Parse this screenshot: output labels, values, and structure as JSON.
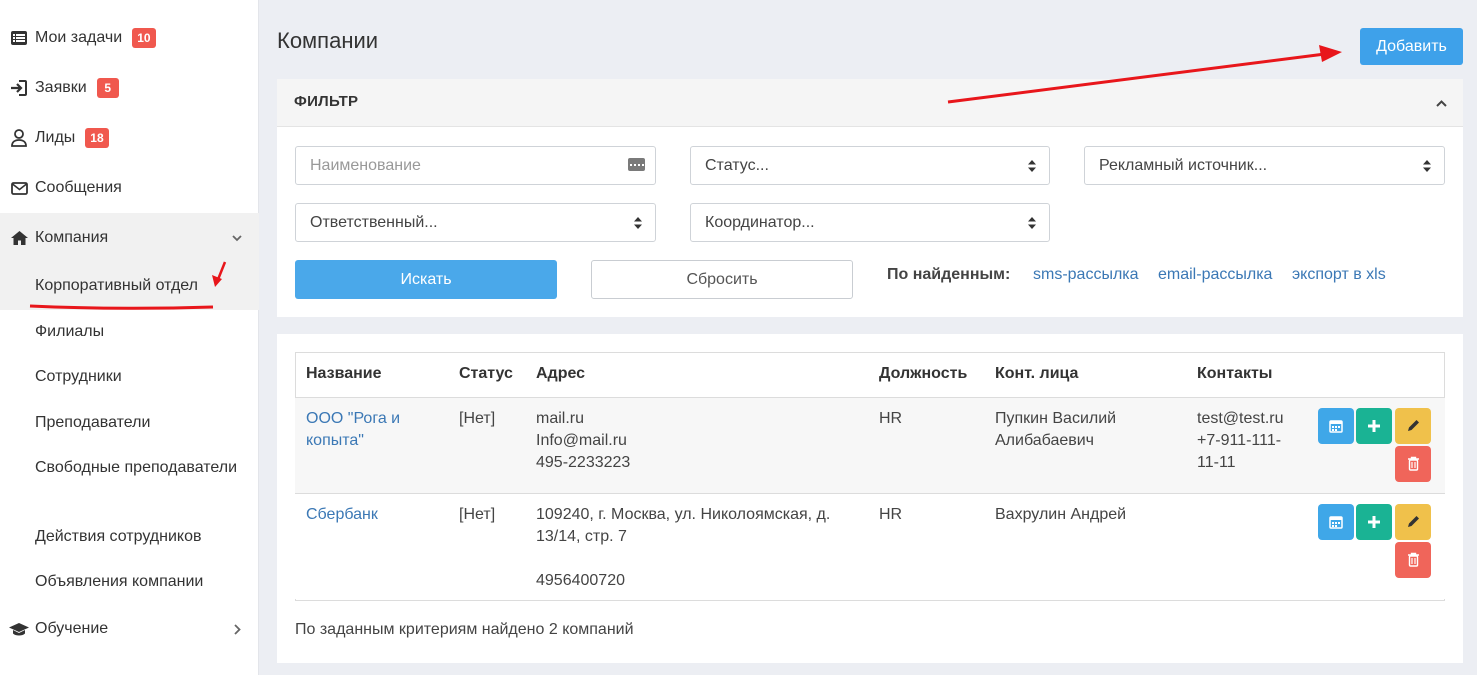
{
  "sidebar": {
    "items": [
      {
        "label": "Мои задачи",
        "badge": "10",
        "icon": "list-icon"
      },
      {
        "label": "Заявки",
        "badge": "5",
        "icon": "sign-in-icon"
      },
      {
        "label": "Лиды",
        "badge": "18",
        "icon": "user-icon"
      },
      {
        "label": "Сообщения",
        "icon": "envelope-icon"
      },
      {
        "label": "Компания",
        "icon": "home-icon"
      }
    ],
    "submenu": [
      "Корпоративный отдел",
      "Филиалы",
      "Сотрудники",
      "Преподаватели",
      "Свободные преподаватели",
      "Действия сотрудников",
      "Объявления компании"
    ],
    "after": {
      "label": "Обучение",
      "icon": "graduation-cap-icon"
    }
  },
  "header": {
    "title": "Компании",
    "add_label": "Добавить"
  },
  "filter": {
    "title": "ФИЛЬТР",
    "name_placeholder": "Наименование",
    "status": "Статус...",
    "ad_source": "Рекламный источник...",
    "responsible": "Ответственный...",
    "coordinator": "Координатор...",
    "search_label": "Искать",
    "reset_label": "Сбросить",
    "found_label": "По найденным:",
    "links": [
      "sms-рассылка",
      "email-рассылка",
      "экспорт в xls"
    ]
  },
  "table": {
    "columns": [
      "Название",
      "Статус",
      "Адрес",
      "Должность",
      "Конт. лица",
      "Контакты"
    ],
    "rows": [
      {
        "name": "ООО \"Рога и копыта\"",
        "status": "[Нет]",
        "address": [
          "mail.ru",
          "Info@mail.ru",
          "495-2233223"
        ],
        "position": "HR",
        "contact_person": "Пупкин Василий Алибабаевич",
        "contacts": [
          "test@test.ru",
          "+7-911-111-11-11"
        ]
      },
      {
        "name": "Сбербанк",
        "status": "[Нет]",
        "address": [
          "109240, г. Москва, ул. Николоямская, д. 13/14, стр. 7",
          "",
          "4956400720"
        ],
        "position": "HR",
        "contact_person": "Вахрулин Андрей",
        "contacts": []
      }
    ],
    "results": "По заданным критериям найдено 2 компаний"
  },
  "colors": {
    "primary": "#3ea1ea",
    "badge": "#f0584e",
    "success": "#1ab394",
    "warning": "#f0c14b",
    "danger": "#f0655a",
    "link": "#3b78b5",
    "annotation": "#e8161b"
  }
}
